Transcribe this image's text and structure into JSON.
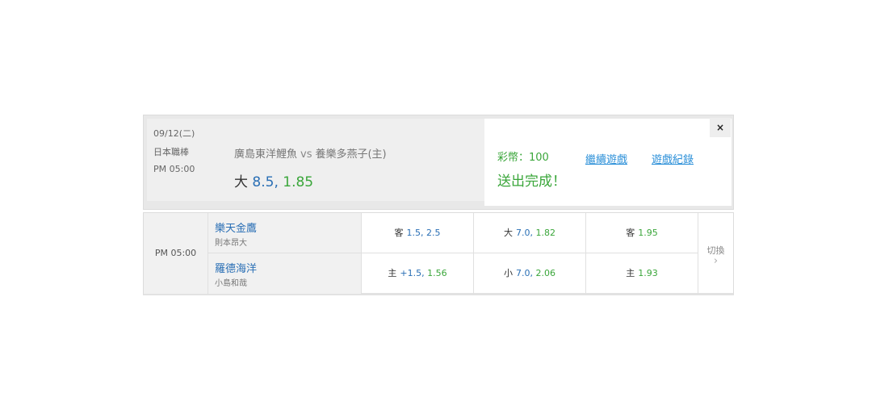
{
  "confirm": {
    "date": "09/12(二)",
    "league": "日本職棒",
    "time": "PM 05:00",
    "away_team": "廣島東洋鯉魚",
    "vs": "vs",
    "home_team": "養樂多燕子(主)",
    "pick_label": "大",
    "pick_line": "8.5,",
    "pick_odds": "1.85",
    "coins": "彩幣：100",
    "status": "送出完成！",
    "continue_label": "繼續遊戲",
    "history_label": "遊戲紀錄",
    "close_label": "×"
  },
  "table": {
    "time": "PM 05:00",
    "teams": [
      {
        "name": "樂天金鷹",
        "pitcher": "則本昂大"
      },
      {
        "name": "羅德海洋",
        "pitcher": "小島和哉"
      }
    ],
    "rows": [
      {
        "spread": {
          "label": "客",
          "line": "1.5,",
          "odds": "2.5"
        },
        "total": {
          "label": "大",
          "line": "7.0,",
          "odds": "1.82"
        },
        "moneyline": {
          "label": "客",
          "odds": "1.95"
        }
      },
      {
        "spread": {
          "label": "主",
          "line": "+1.5,",
          "odds": "1.56"
        },
        "total": {
          "label": "小",
          "line": "7.0,",
          "odds": "2.06"
        },
        "moneyline": {
          "label": "主",
          "odds": "1.93"
        }
      }
    ],
    "switch_label": "切換",
    "switch_icon": "›"
  },
  "colors": {
    "accent_blue": "#2a6fb5",
    "accent_green": "#3aa63a",
    "link_blue": "#2a8fd8"
  }
}
